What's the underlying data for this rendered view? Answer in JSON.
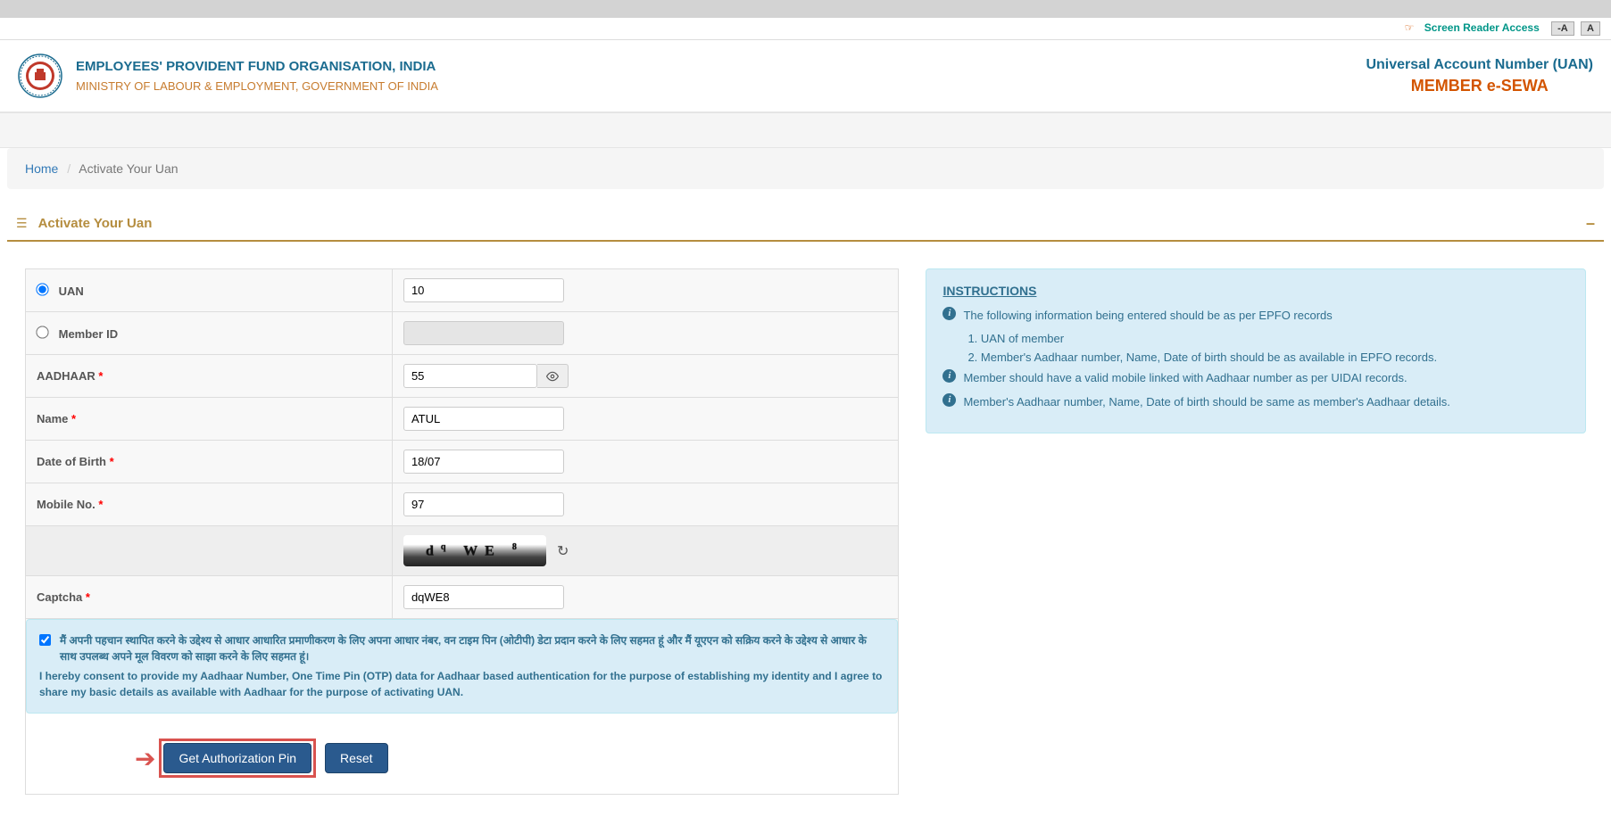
{
  "util": {
    "sra": "Screen Reader Access",
    "font_down": "-A",
    "font_up": "A"
  },
  "header": {
    "org": "EMPLOYEES' PROVIDENT FUND ORGANISATION, INDIA",
    "ministry": "MINISTRY OF LABOUR & EMPLOYMENT, GOVERNMENT OF INDIA",
    "uan": "Universal Account Number (UAN)",
    "esewa": "MEMBER e-SEWA"
  },
  "breadcrumb": {
    "home": "Home",
    "current": "Activate Your Uan"
  },
  "panel": {
    "title": "Activate Your Uan"
  },
  "form": {
    "uan_label": "UAN",
    "uan_value": "10",
    "memberid_label": "Member ID",
    "memberid_value": "",
    "aadhaar_label": "AADHAAR",
    "aadhaar_value": "55",
    "name_label": "Name",
    "name_value": "ATUL",
    "dob_label": "Date of Birth",
    "dob_value": "18/07",
    "mobile_label": "Mobile No.",
    "mobile_value": "97",
    "captcha_label": "Captcha",
    "captcha_value": "dqWE8",
    "captcha_image_text": "d q WE 8"
  },
  "consent": {
    "hi": "मैं अपनी पहचान स्थापित करने के उद्देश्य से आधार आधारित प्रमाणीकरण के लिए अपना आधार नंबर, वन टाइम पिन (ओटीपी) डेटा प्रदान करने के लिए सहमत हूं और मैं यूएएन को सक्रिय करने के उद्देश्य से आधार के साथ उपलब्ध अपने मूल विवरण को साझा करने के लिए सहमत हूं।",
    "en": "I hereby consent to provide my Aadhaar Number, One Time Pin (OTP) data for Aadhaar based authentication for the purpose of establishing my identity and I agree to share my basic details as available with Aadhaar for the purpose of activating UAN."
  },
  "buttons": {
    "auth": "Get Authorization Pin",
    "reset": "Reset"
  },
  "instructions": {
    "title": "INSTRUCTIONS",
    "l1": "The following information being entered should be as per EPFO records",
    "l1a": "1. UAN of member",
    "l1b": "2. Member's Aadhaar number, Name, Date of birth should be as available in EPFO records.",
    "l2": "Member should have a valid mobile linked with Aadhaar number as per UIDAI records.",
    "l3": "Member's Aadhaar number, Name, Date of birth should be same as member's Aadhaar details."
  }
}
